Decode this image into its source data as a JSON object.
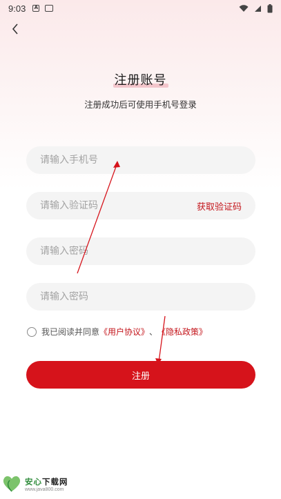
{
  "status_bar": {
    "time": "9:03",
    "icon1": "A",
    "icon2": "message-icon"
  },
  "header": {
    "title": "注册账号",
    "subtitle": "注册成功后可使用手机号登录"
  },
  "form": {
    "phone_placeholder": "请输入手机号",
    "code_placeholder": "请输入验证码",
    "get_code_label": "获取验证码",
    "password_placeholder": "请输入密码",
    "confirm_placeholder": "请输入密码"
  },
  "agreement": {
    "prefix": "我已阅读并同意",
    "user_agreement": "《用户协议》",
    "separator": "、",
    "privacy_policy": "《隐私政策》"
  },
  "register_label": "注册",
  "watermark": {
    "main_green": "安心",
    "main_dark": "下载网",
    "sub": "www.java800.com"
  },
  "colors": {
    "accent": "#d6131b",
    "link": "#c4161c",
    "field_bg": "#f4f4f4"
  }
}
